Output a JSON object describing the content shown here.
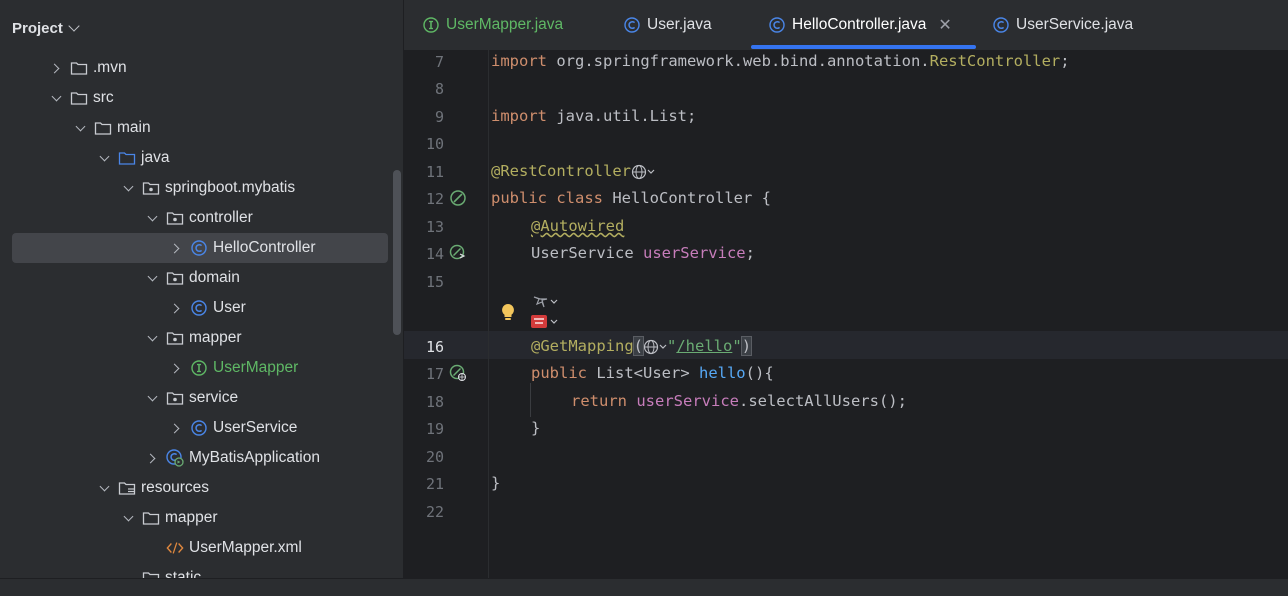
{
  "sidebar": {
    "title": "Project",
    "items": [
      {
        "label": ".mvn",
        "depth": 3,
        "arrow": "closed",
        "icon": "folder-icon"
      },
      {
        "label": "src",
        "depth": 3,
        "arrow": "open",
        "icon": "folder-icon"
      },
      {
        "label": "main",
        "depth": 4,
        "arrow": "open",
        "icon": "folder-icon"
      },
      {
        "label": "java",
        "depth": 5,
        "arrow": "open",
        "icon": "source-folder-icon"
      },
      {
        "label": "springboot.mybatis",
        "depth": 6,
        "arrow": "open",
        "icon": "package-icon"
      },
      {
        "label": "controller",
        "depth": 7,
        "arrow": "open",
        "icon": "package-icon"
      },
      {
        "label": "HelloController",
        "depth": 8,
        "arrow": "closed",
        "icon": "class-icon",
        "selected": true
      },
      {
        "label": "domain",
        "depth": 7,
        "arrow": "open",
        "icon": "package-icon"
      },
      {
        "label": "User",
        "depth": 8,
        "arrow": "closed",
        "icon": "class-icon"
      },
      {
        "label": "mapper",
        "depth": 7,
        "arrow": "open",
        "icon": "package-icon"
      },
      {
        "label": "UserMapper",
        "depth": 8,
        "arrow": "closed",
        "icon": "interface-icon",
        "green": true
      },
      {
        "label": "service",
        "depth": 7,
        "arrow": "open",
        "icon": "package-icon"
      },
      {
        "label": "UserService",
        "depth": 8,
        "arrow": "closed",
        "icon": "class-icon"
      },
      {
        "label": "MyBatisApplication",
        "depth": 7,
        "arrow": "closed",
        "icon": "spring-app-icon"
      },
      {
        "label": "resources",
        "depth": 5,
        "arrow": "open",
        "icon": "resources-folder-icon"
      },
      {
        "label": "mapper",
        "depth": 6,
        "arrow": "open",
        "icon": "folder-icon"
      },
      {
        "label": "UserMapper.xml",
        "depth": 7,
        "arrow": "none",
        "icon": "xml-icon"
      },
      {
        "label": "static",
        "depth": 6,
        "arrow": "none",
        "icon": "folder-icon"
      }
    ]
  },
  "tabs": [
    {
      "label": "UserMapper.java",
      "icon": "interface-icon",
      "green": true
    },
    {
      "label": "User.java",
      "icon": "class-icon"
    },
    {
      "label": "HelloController.java",
      "icon": "class-icon",
      "active": true
    },
    {
      "label": "UserService.java",
      "icon": "class-icon"
    }
  ],
  "editor": {
    "current_line": "16",
    "line_numbers": [
      "7",
      "8",
      "9",
      "10",
      "11",
      "12",
      "13",
      "14",
      "15",
      "16",
      "17",
      "18",
      "19",
      "20",
      "21",
      "22"
    ],
    "code": {
      "l7_import": "import",
      "l7_pkg": " org.springframework.web.bind.annotation.",
      "l7_cls": "RestController",
      "l7_end": ";",
      "l9_import": "import",
      "l9_rest": " java.util.List;",
      "l11_ann": "@RestController",
      "l12_public": "public",
      "l12_class": "class",
      "l12_rest": " HelloController {",
      "l13_ann": "@Autowired",
      "l14_type": "UserService ",
      "l14_field": "userService",
      "l14_end": ";",
      "l16_ann": "@GetMapping",
      "l16_open": "(",
      "l16_q1": "\"",
      "l16_path": "/hello",
      "l16_q2": "\"",
      "l16_close": ")",
      "l17_public": "public",
      "l17_type": " List<User> ",
      "l17_fn": "hello",
      "l17_end": "(){",
      "l18_return": "return",
      "l18_field": " userService",
      "l18_rest": ".selectAllUsers();",
      "l19": "}",
      "l21": "}"
    }
  },
  "colors": {
    "accent": "#3574f0",
    "keyword": "#cf8e6d",
    "annotation": "#b3ae60",
    "field": "#c77dbb",
    "function": "#56a8f5",
    "string": "#6aab73",
    "class_icon": "#4a86e8",
    "interface_icon": "#5fb865"
  }
}
